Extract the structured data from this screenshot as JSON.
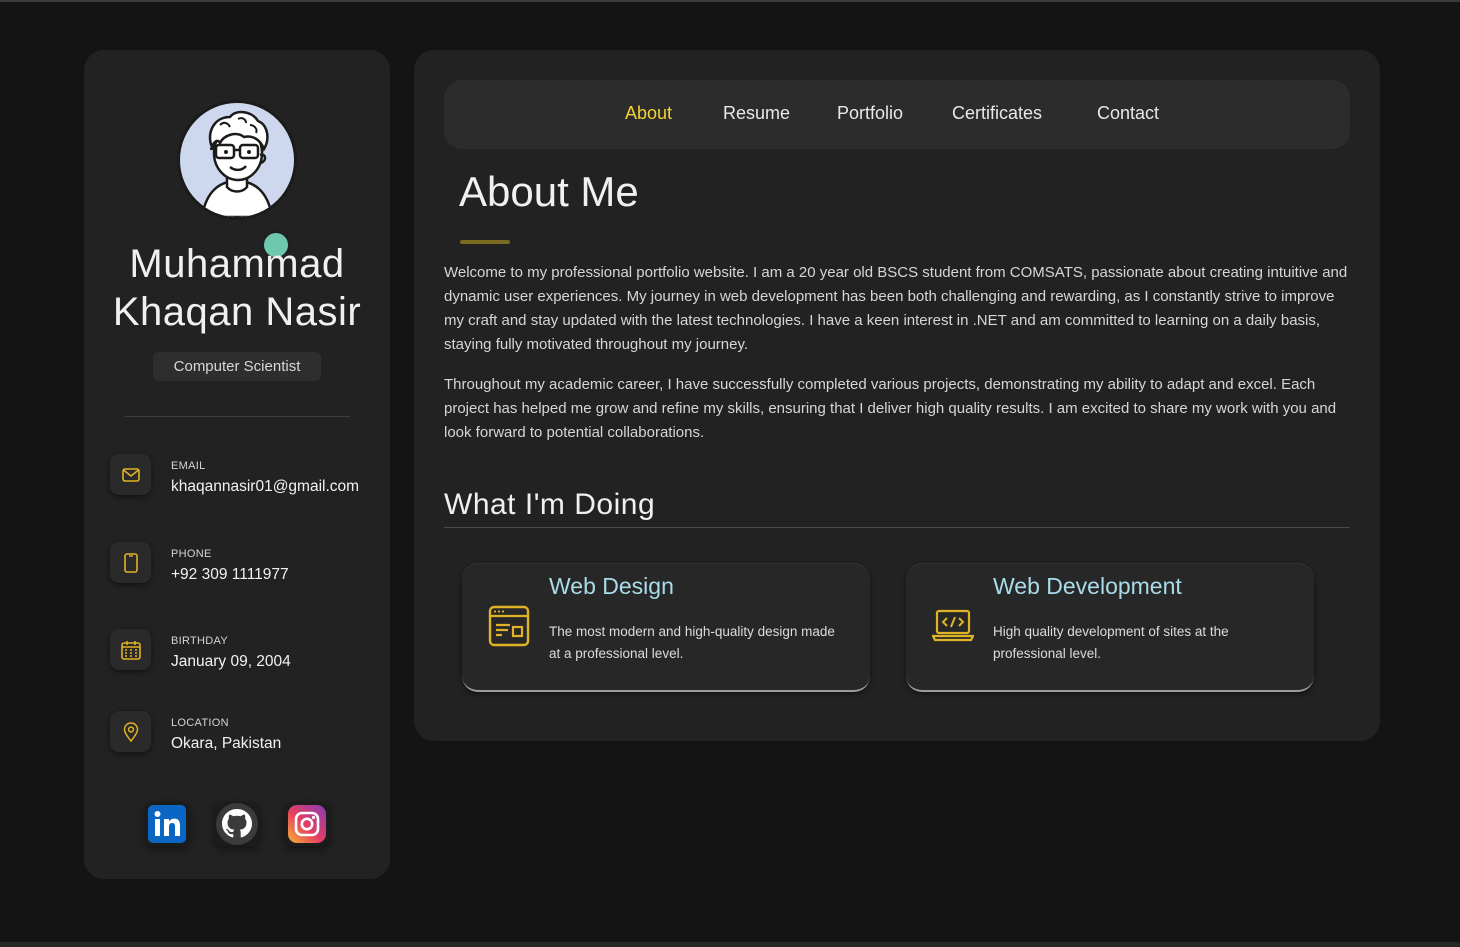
{
  "profile": {
    "name": "Muhammad Khaqan Nasir",
    "title": "Computer Scientist"
  },
  "contacts": [
    {
      "label": "EMAIL",
      "value": "khaqannasir01@gmail.com",
      "icon": "mail-icon"
    },
    {
      "label": "PHONE",
      "value": "+92 309 1111977",
      "icon": "phone-icon"
    },
    {
      "label": "BIRTHDAY",
      "value": "January 09, 2004",
      "icon": "calendar-icon"
    },
    {
      "label": "LOCATION",
      "value": "Okara, Pakistan",
      "icon": "location-pin-icon"
    }
  ],
  "socials": [
    {
      "name": "linkedin-icon"
    },
    {
      "name": "github-icon"
    },
    {
      "name": "instagram-icon"
    }
  ],
  "nav": {
    "items": [
      "About",
      "Resume",
      "Portfolio",
      "Certificates",
      "Contact"
    ],
    "active": "About"
  },
  "about": {
    "heading": "About Me",
    "paragraphs": [
      "Welcome to my professional portfolio website. I am a 20  year  old BSCS student from COMSATS, passionate about creating intuitive and dynamic user experiences. My journey in web development has been both challenging and rewarding, as I constantly strive to improve my craft and stay updated with the latest technologies. I have a keen interest in .NET and am committed to learning on a daily basis, staying fully motivated throughout my journey.",
      "Throughout my academic career, I have successfully completed various projects, demonstrating my ability to adapt and excel. Each project has helped me grow and refine my skills, ensuring that I deliver high  quality results. I am excited to share my work with you and look forward to potential collaborations."
    ]
  },
  "services": {
    "heading": "What I'm Doing",
    "items": [
      {
        "title": "Web Design",
        "text": "The most modern and high-quality design made at a professional level.",
        "icon": "web-design-icon"
      },
      {
        "title": "Web Development",
        "text": "High quality development of sites at the professional level.",
        "icon": "code-laptop-icon"
      }
    ]
  },
  "colors": {
    "accent": "#f4d332",
    "icon": "#e0b225",
    "service_title": "#a9dbe9",
    "status_online": "#6ec8ae"
  }
}
